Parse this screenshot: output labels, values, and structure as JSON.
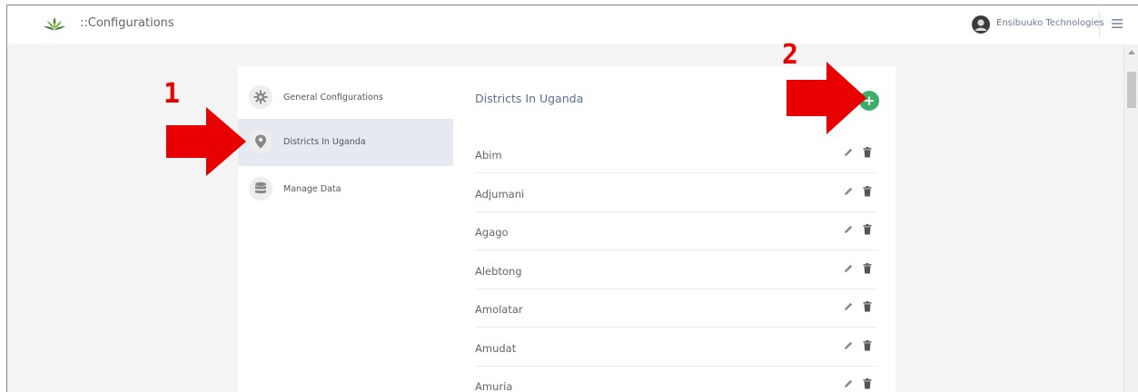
{
  "header": {
    "title": "::Configurations",
    "user_name": "Ensibuuko Technologies"
  },
  "sidebar": {
    "items": [
      {
        "label": "General Configurations",
        "icon": "gear-icon",
        "active": false
      },
      {
        "label": "Districts In Uganda",
        "icon": "location-pin-icon",
        "active": true
      },
      {
        "label": "Manage Data",
        "icon": "database-icon",
        "active": false
      }
    ]
  },
  "main": {
    "title": "Districts In Uganda",
    "add_label": "+",
    "rows": [
      "Abim",
      "Adjumani",
      "Agago",
      "Alebtong",
      "Amolatar",
      "Amudat",
      "Amuria"
    ]
  },
  "annotations": {
    "step1": "1",
    "step2": "2"
  },
  "colors": {
    "accent": "#3dae6a",
    "annotation": "#e80000",
    "active_nav": "#e6e9f0",
    "title_blue": "#5a6e9a"
  }
}
